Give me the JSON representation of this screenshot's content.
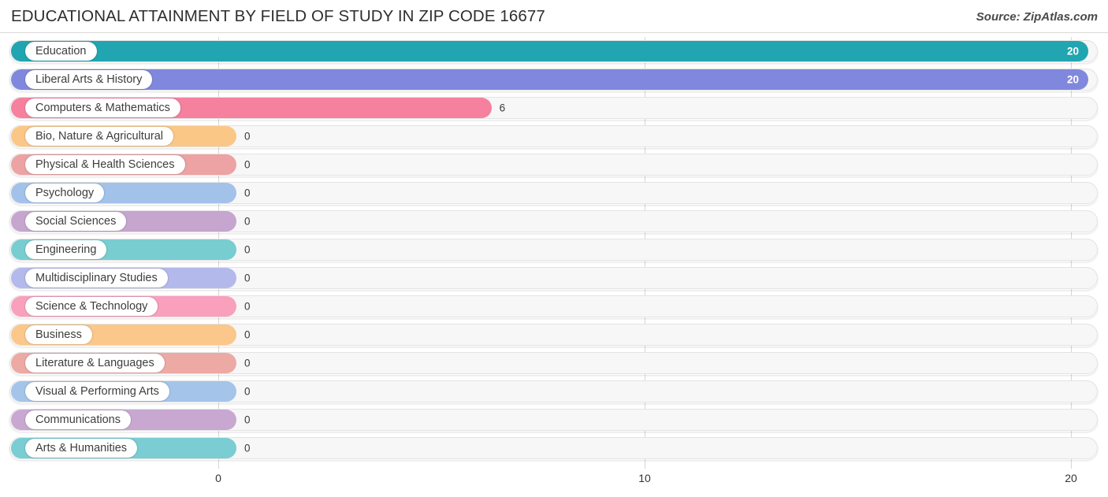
{
  "header": {
    "title": "EDUCATIONAL ATTAINMENT BY FIELD OF STUDY IN ZIP CODE 16677",
    "source": "Source: ZipAtlas.com"
  },
  "chart_data": {
    "type": "bar",
    "orientation": "horizontal",
    "title": "EDUCATIONAL ATTAINMENT BY FIELD OF STUDY IN ZIP CODE 16677",
    "xlabel": "",
    "ylabel": "",
    "xlim": [
      0,
      20
    ],
    "xticks": [
      0,
      10,
      20
    ],
    "xtick_labels": [
      "0",
      "10",
      "20"
    ],
    "grid": true,
    "legend": "none",
    "categories": [
      "Education",
      "Liberal Arts & History",
      "Computers & Mathematics",
      "Bio, Nature & Agricultural",
      "Physical & Health Sciences",
      "Psychology",
      "Social Sciences",
      "Engineering",
      "Multidisciplinary Studies",
      "Science & Technology",
      "Business",
      "Literature & Languages",
      "Visual & Performing Arts",
      "Communications",
      "Arts & Humanities"
    ],
    "values": [
      20,
      20,
      6,
      0,
      0,
      0,
      0,
      0,
      0,
      0,
      0,
      0,
      0,
      0,
      0
    ],
    "value_labels": [
      "20",
      "20",
      "6",
      "0",
      "0",
      "0",
      "0",
      "0",
      "0",
      "0",
      "0",
      "0",
      "0",
      "0",
      "0"
    ],
    "colors": [
      "#21a5b0",
      "#8088de",
      "#f5819f",
      "#fbc786",
      "#eda3a3",
      "#a3c2ea",
      "#c6a5cf",
      "#78cdd1",
      "#b4b9ec",
      "#f9a0bd",
      "#fbc78a",
      "#eda9a4",
      "#a4c4ea",
      "#c8a8d1",
      "#79cdd3"
    ]
  }
}
